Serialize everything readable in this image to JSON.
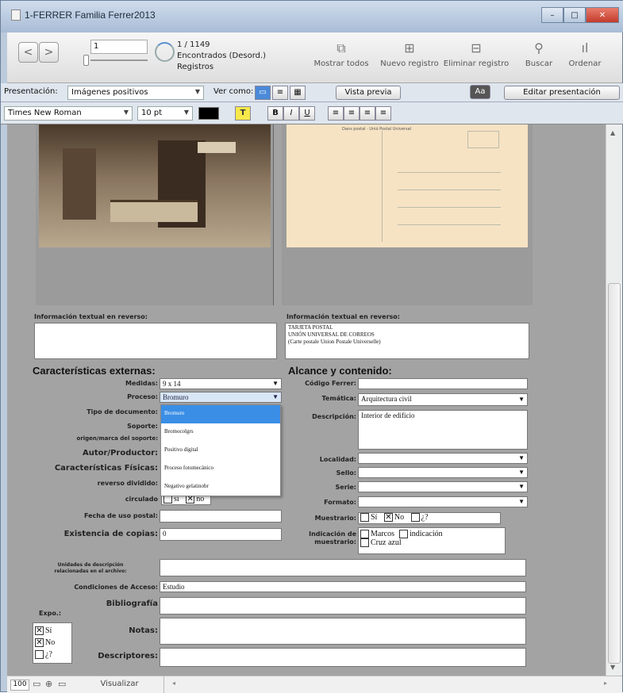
{
  "window": {
    "title": "1-FERRER Familia Ferrer2013",
    "btn_min": "–",
    "btn_max": "□",
    "btn_close": "✕"
  },
  "toolbar": {
    "prev": "<",
    "next": ">",
    "record_number": "1",
    "record_position": "1 / 1149",
    "found_text": "Encontrados (Desord.)",
    "records_label": "Registros",
    "show_all": "Mostrar todos",
    "new_record": "Nuevo registro",
    "delete_record": "Eliminar registro",
    "find": "Buscar",
    "sort": "Ordenar"
  },
  "layoutbar": {
    "layout_label": "Presentación:",
    "layout_value": "Imágenes positivos",
    "view_as": "Ver como:",
    "preview": "Vista previa",
    "aa": "Aa",
    "edit_layout": "Editar presentación"
  },
  "formatbar": {
    "font": "Times New Roman",
    "size": "10 pt",
    "text_color_btn": "T",
    "bold": "B",
    "italic": "I",
    "underline": "U"
  },
  "form": {
    "info_reverso_left_label": "Información textual en reverso:",
    "info_reverso_left_value": "",
    "info_reverso_right_label": "Información textual en reverso:",
    "info_reverso_right_lines": [
      "TARJETA POSTAL",
      "UNIÓN UNIVERSAL DE CORREOS",
      "(Carte postale Union Postale Universelle)"
    ],
    "postcard_header": "Dans postal · Unió Postal Universal",
    "caract_header": "Características externas:",
    "alcance_header": "Alcance y contenido:",
    "medidas_label": "Medidas:",
    "medidas_value": "9 x 14",
    "proceso_label": "Proceso:",
    "proceso_value": "Bromuro",
    "tipo_doc_label": "Tipo de documento:",
    "soporte_label": "Soporte:",
    "origen_label": "origen/marca del soporte:",
    "autor_label": "Autor/Productor:",
    "caract_fisicas_label": "Características Físicas:",
    "reverso_dividido_label": "reverso dividido:",
    "circulado_label": "circulado",
    "circulado_si": "sí",
    "circulado_no": "no",
    "fecha_label": "Fecha de uso postal:",
    "existencia_label": "Existencia de copias:",
    "existencia_value": "0",
    "codigo_label": "Código Ferrer:",
    "tematica_label": "Temática:",
    "tematica_value": "Arquitectura civil",
    "descripcion_label": "Descripción:",
    "descripcion_value": "Interior de edificio",
    "localidad_label": "Localidad:",
    "sello_label": "Sello:",
    "serie_label": "Serie:",
    "formato_label": "Formato:",
    "muestrario_label": "Muestrario:",
    "muestrario_si": "Sí",
    "muestrario_no": "No",
    "muestrario_q": "¿?",
    "indicacion_label_1": "Indicación de",
    "indicacion_label_2": "muestrario:",
    "ind_marcos": "Marcos",
    "ind_indicacion": "indicación",
    "ind_cruz": "Cruz azul",
    "unidades_label_1": "Unidades de descripción",
    "unidades_label_2": "relacionadas en el archivo:",
    "condiciones_label": "Condiciones de Acceso:",
    "condiciones_value": "Estudio",
    "bibliografia_label": "Bibliografía",
    "expo_label": "Expo.:",
    "expo_si": "Sí",
    "expo_no": "No",
    "expo_q": "¿?",
    "notas_label": "Notas:",
    "descriptores_label": "Descriptores:",
    "dropdown_options": [
      "Bromuro",
      "Bromocolgrs",
      "Positivo digital",
      "Proceso fotomecánico",
      "Negativo gelatinobr"
    ]
  },
  "statusbar": {
    "zoom": "100",
    "mode": "Visualizar"
  }
}
